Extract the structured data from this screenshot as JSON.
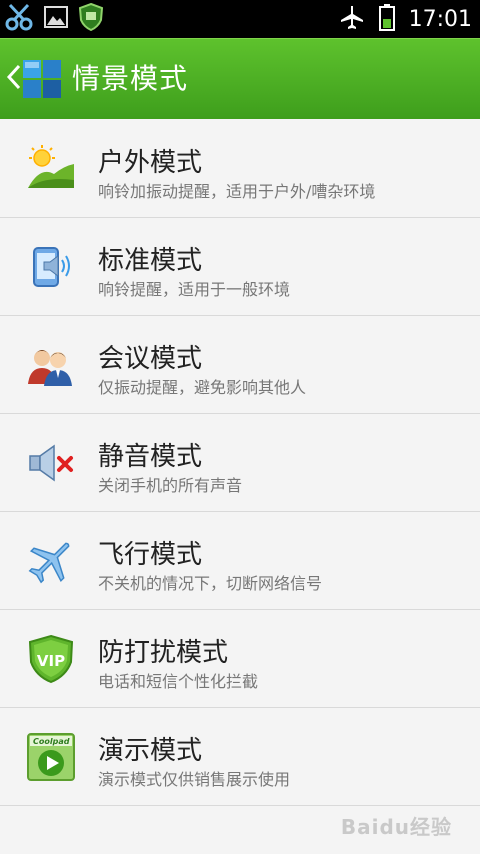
{
  "status_bar": {
    "left_icons": [
      "scissors-icon",
      "image-icon",
      "security-shield-icon"
    ],
    "right_icons": [
      "airplane-mode-icon",
      "battery-icon"
    ],
    "time": "17:01"
  },
  "header": {
    "back_icon": "chevron-left-icon",
    "app_icon": "grid-squares-icon",
    "title": "情景模式",
    "accent_color": "#4caf22"
  },
  "modes": [
    {
      "name": "户外模式",
      "description": "响铃加振动提醒，适用于户外/嘈杂环境",
      "icon": "outdoor-sun-hill-icon"
    },
    {
      "name": "标准模式",
      "description": "响铃提醒，适用于一般环境",
      "icon": "phone-speaker-icon"
    },
    {
      "name": "会议模式",
      "description": "仅振动提醒，避免影响其他人",
      "icon": "meeting-people-icon"
    },
    {
      "name": "静音模式",
      "description": "关闭手机的所有声音",
      "icon": "speaker-muted-icon"
    },
    {
      "name": "飞行模式",
      "description": "不关机的情况下，切断网络信号",
      "icon": "airplane-icon"
    },
    {
      "name": "防打扰模式",
      "description": "电话和短信个性化拦截",
      "icon": "vip-shield-icon"
    },
    {
      "name": "演示模式",
      "description": "演示模式仅供销售展示使用",
      "icon": "coolpad-play-icon",
      "icon_text": "Coolpad"
    }
  ],
  "watermark": "Baidu经验"
}
